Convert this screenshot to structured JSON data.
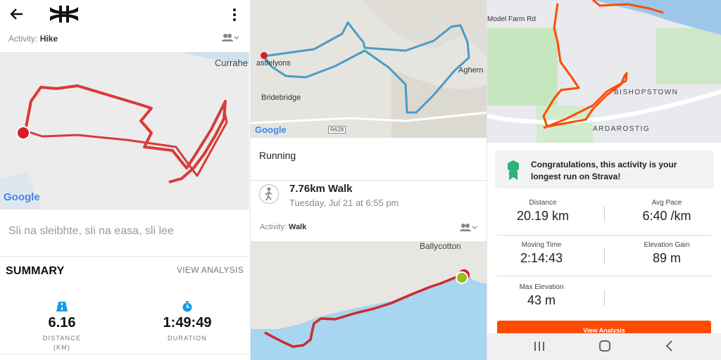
{
  "panel1": {
    "activity_label": "Activity:",
    "activity_type": "Hike",
    "map_place": "Currahe",
    "google": "Google",
    "note": "Sli na sleibhte, sli na easa, sli lee",
    "summary_title": "SUMMARY",
    "view_analysis": "VIEW ANALYSIS",
    "distance_value": "6.16",
    "distance_label": "DISTANCE",
    "distance_unit": "(KM)",
    "duration_value": "1:49:49",
    "duration_label": "DURATION",
    "route_color": "#d93a3a"
  },
  "panel2": {
    "map_labels": {
      "castlelyons": "astlelyons",
      "bridebridge": "Bridebridge",
      "aghern": "Aghern",
      "road": "R628",
      "google": "Google"
    },
    "running": "Running",
    "walk_title": "7.76km Walk",
    "walk_date": "Tuesday, Jul 21 at 6:55 pm",
    "activity_label": "Activity:",
    "activity_type": "Walk",
    "ballycotton": "Ballycotton",
    "route_color": "#4a9bc7",
    "walk_route_color": "#cc2b2b"
  },
  "panel3": {
    "map_labels": {
      "model_farm": "Model Farm Rd",
      "bishopstown": "BISHOPSTOWN",
      "ardarostig": "ARDAROSTIG"
    },
    "congrats": "Congratulations, this activity is your longest run on Strava!",
    "stats": {
      "distance_label": "Distance",
      "distance_value": "20.19 km",
      "pace_label": "Avg Pace",
      "pace_value": "6:40 /km",
      "moving_label": "Moving Time",
      "moving_value": "2:14:43",
      "elevation_gain_label": "Elevation Gain",
      "elevation_gain_value": "89 m",
      "max_elev_label": "Max Elevation",
      "max_elev_value": "43 m"
    },
    "view_analysis": "View Analysis",
    "accent": "#fc4c02",
    "badge_color": "#2db37a"
  }
}
